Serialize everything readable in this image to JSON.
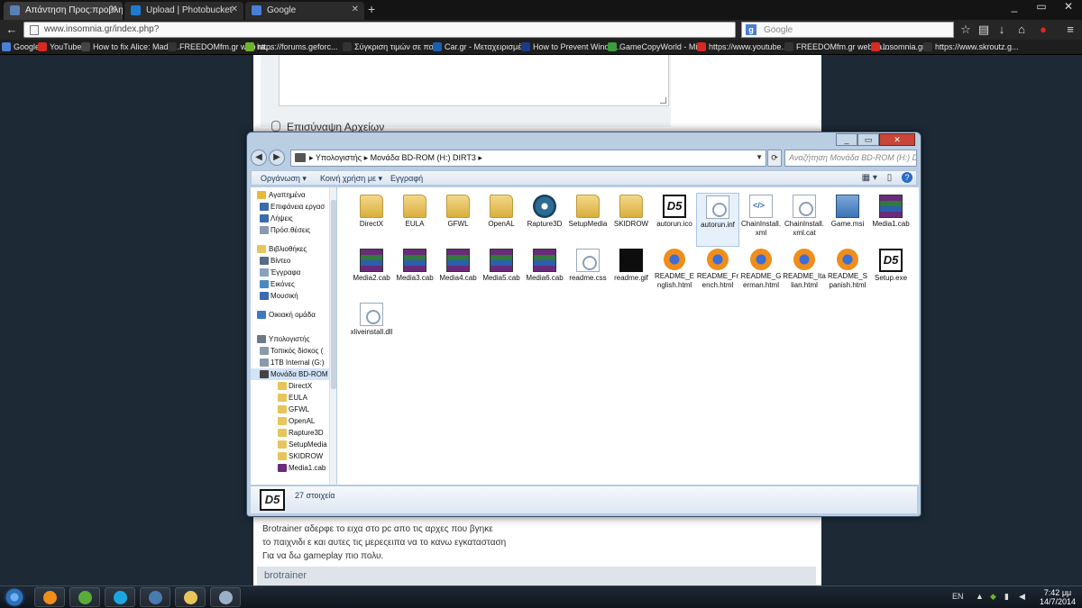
{
  "browser": {
    "tabs": [
      {
        "label": "Απάντηση Προς:προβλη...",
        "active": true,
        "color": "#5b7fb6"
      },
      {
        "label": "Upload | Photobucket",
        "active": false,
        "color": "#1f7bd1"
      },
      {
        "label": "Google",
        "active": false,
        "color": "#4a7fd8"
      }
    ],
    "url": "www.insomnia.gr/index.php?",
    "search_placeholder": "Google",
    "search_engine_initial": "g",
    "bookmarks": [
      {
        "label": "Google",
        "color": "#4a7fd8"
      },
      {
        "label": "YouTube",
        "color": "#d72a23"
      },
      {
        "label": "How to fix Alice: Madn...",
        "color": "#444444"
      },
      {
        "label": "FREEDOMfm.gr web ra...",
        "color": "#333333"
      },
      {
        "label": "https://forums.geforc...",
        "color": "#6bb52a"
      },
      {
        "label": "Σύγκριση τιμών σε πο...",
        "color": "#333333"
      },
      {
        "label": "Car.gr - Μεταχειρισμέ...",
        "color": "#1a5fae"
      },
      {
        "label": "How to Prevent Windo...",
        "color": "#1a3a8a"
      },
      {
        "label": "GameCopyWorld - Mir...",
        "color": "#3a9c3a"
      },
      {
        "label": "https://www.youtube....",
        "color": "#d72a23"
      },
      {
        "label": "FREEDOMfm.gr web ra...",
        "color": "#333333"
      },
      {
        "label": "Insomnia.gr",
        "color": "#d72a23"
      },
      {
        "label": "https://www.skroutz.g...",
        "color": "#333333"
      }
    ]
  },
  "webpage": {
    "attach_label": "Επισύναψη Αρχείων",
    "post_lines": [
      "Brotrainer αδερφε το ειχα στο pc απο τις αρχες που βγηκε",
      "το παιχνιδι ε και αυτες τις μερεςειπα να το κανω εγκατασταση",
      "Για να δω gameplay πιο πολυ."
    ],
    "author": "brotrainer"
  },
  "explorer": {
    "path": [
      "Υπολογιστής",
      "Μονάδα BD-ROM (H:) DIRT3"
    ],
    "search_placeholder": "Αναζήτηση Μονάδα BD-ROM (H:) DI...",
    "commands": [
      "Οργάνωση ▾",
      "Κοινή χρήση με ▾",
      "Εγγραφή"
    ],
    "nav": [
      {
        "label": "Αγαπημένα",
        "kind": "header",
        "color": "#e8b93a"
      },
      {
        "label": "Επιφάνεια εργασ",
        "kind": "l1",
        "color": "#3a6ab0"
      },
      {
        "label": "Λήψεις",
        "kind": "l1",
        "color": "#3a6ab0"
      },
      {
        "label": "Πρόσ.θέσεις",
        "kind": "l1",
        "color": "#8a9ab0"
      },
      {
        "label": "Βιβλιοθήκες",
        "kind": "header",
        "color": "#e8c55a"
      },
      {
        "label": "Βίντεο",
        "kind": "l1",
        "color": "#5a6a8a"
      },
      {
        "label": "Έγγραφα",
        "kind": "l1",
        "color": "#8aa0c0"
      },
      {
        "label": "Εικόνες",
        "kind": "l1",
        "color": "#4a8ac0"
      },
      {
        "label": "Μουσική",
        "kind": "l1",
        "color": "#3a6ab0"
      },
      {
        "label": "Οικιακή ομάδα",
        "kind": "header",
        "color": "#3a7ac0"
      },
      {
        "label": "Υπολογιστής",
        "kind": "header",
        "color": "#6a7a8a"
      },
      {
        "label": "Τοπικός δίσκος (",
        "kind": "l1",
        "color": "#8a9aaa"
      },
      {
        "label": "1TB Internal (G:)",
        "kind": "l1",
        "color": "#8a9aaa"
      },
      {
        "label": "Μονάδα BD-ROM",
        "kind": "l1sel",
        "color": "#444444"
      },
      {
        "label": "DirectX",
        "kind": "l2",
        "color": "#e8c55a"
      },
      {
        "label": "EULA",
        "kind": "l2",
        "color": "#e8c55a"
      },
      {
        "label": "GFWL",
        "kind": "l2",
        "color": "#e8c55a"
      },
      {
        "label": "OpenAL",
        "kind": "l2",
        "color": "#e8c55a"
      },
      {
        "label": "Rapture3D",
        "kind": "l2",
        "color": "#e8c55a"
      },
      {
        "label": "SetupMedia",
        "kind": "l2",
        "color": "#e8c55a"
      },
      {
        "label": "SKIDROW",
        "kind": "l2",
        "color": "#e8c55a"
      },
      {
        "label": "Media1.cab",
        "kind": "l2",
        "color": "#6a2b7a"
      }
    ],
    "files": [
      {
        "name": "DirectX",
        "type": "folder"
      },
      {
        "name": "EULA",
        "type": "folder"
      },
      {
        "name": "GFWL",
        "type": "folder"
      },
      {
        "name": "OpenAL",
        "type": "folder"
      },
      {
        "name": "Rapture3D",
        "type": "disc"
      },
      {
        "name": "SetupMedia",
        "type": "folder"
      },
      {
        "name": "SKIDROW",
        "type": "folder"
      },
      {
        "name": "autorun.ico",
        "type": "d5"
      },
      {
        "name": "autorun.inf",
        "type": "doc",
        "selected": true
      },
      {
        "name": "ChainInstall.xml",
        "type": "xml"
      },
      {
        "name": "ChainInstall.xml.cat",
        "type": "doc"
      },
      {
        "name": "Game.msi",
        "type": "msi"
      },
      {
        "name": "Media1.cab",
        "type": "rar"
      },
      {
        "name": "Media2.cab",
        "type": "rar"
      },
      {
        "name": "Media3.cab",
        "type": "rar"
      },
      {
        "name": "Media4.cab",
        "type": "rar"
      },
      {
        "name": "Media5.cab",
        "type": "rar"
      },
      {
        "name": "Media6.cab",
        "type": "rar"
      },
      {
        "name": "readme.css",
        "type": "doc"
      },
      {
        "name": "readme.gif",
        "type": "black"
      },
      {
        "name": "README_English.html",
        "type": "fox"
      },
      {
        "name": "README_French.html",
        "type": "fox"
      },
      {
        "name": "README_German.html",
        "type": "fox"
      },
      {
        "name": "README_Italian.html",
        "type": "fox"
      },
      {
        "name": "README_Spanish.html",
        "type": "fox"
      },
      {
        "name": "Setup.exe",
        "type": "d5"
      },
      {
        "name": "xliveinstall.dll",
        "type": "doc"
      }
    ],
    "item_count": "27 στοιχεία",
    "d5_label": "D5"
  },
  "taskbar": {
    "apps": [
      {
        "name": "firefox",
        "color": "#f08d1b"
      },
      {
        "name": "utorrent",
        "color": "#5aac3a"
      },
      {
        "name": "skype",
        "color": "#1aa7e0"
      },
      {
        "name": "monitor",
        "color": "#4a7ab0"
      },
      {
        "name": "explorer",
        "color": "#e8c55a"
      },
      {
        "name": "notes",
        "color": "#9ab0c8"
      }
    ],
    "lang": "EN",
    "time": "7:42 μμ",
    "date": "14/7/2014"
  }
}
